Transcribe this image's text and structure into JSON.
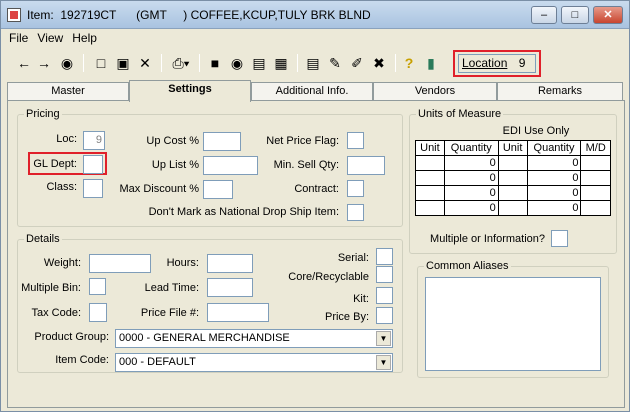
{
  "titlebar": {
    "title": "Item:  192719CT      (GMT     ) COFFEE,KCUP,TULY BRK BLND"
  },
  "menu": [
    {
      "label": "File"
    },
    {
      "label": "View"
    },
    {
      "label": "Help"
    }
  ],
  "location": {
    "label": "Location",
    "value": "9"
  },
  "tabs": [
    {
      "label": "Master"
    },
    {
      "label": "Settings"
    },
    {
      "label": "Additional Info."
    },
    {
      "label": "Vendors"
    },
    {
      "label": "Remarks"
    }
  ],
  "pricing": {
    "legend": "Pricing",
    "loc_label": "Loc:",
    "loc_value": "9",
    "gl_dept_label": "GL Dept:",
    "class_label": "Class:",
    "up_cost_label": "Up Cost %",
    "up_list_label": "Up List %",
    "max_discount_label": "Max Discount %",
    "net_price_flag_label": "Net Price Flag:",
    "min_sell_qty_label": "Min. Sell Qty:",
    "contract_label": "Contract:",
    "national_drop_ship_label": "Don't Mark as National Drop Ship Item:"
  },
  "details": {
    "legend": "Details",
    "weight_label": "Weight:",
    "multiple_bin_label": "Multiple Bin:",
    "tax_code_label": "Tax Code:",
    "hours_label": "Hours:",
    "lead_time_label": "Lead Time:",
    "price_file_label": "Price File #:",
    "serial_label": "Serial:",
    "core_recyclable_label": "Core/Recyclable",
    "kit_label": "Kit:",
    "price_by_label": "Price By:",
    "product_group_label": "Product Group:",
    "product_group_value": "0000 - GENERAL MERCHANDISE",
    "item_code_label": "Item Code:",
    "item_code_value": "000 - DEFAULT"
  },
  "uom": {
    "legend": "Units of Measure",
    "edi_label": "EDI Use Only",
    "headers": [
      "Unit",
      "Quantity",
      "Unit",
      "Quantity",
      "M/D"
    ],
    "rows": [
      [
        "",
        "0",
        "",
        "0",
        ""
      ],
      [
        "",
        "0",
        "",
        "0",
        ""
      ],
      [
        "",
        "0",
        "",
        "0",
        ""
      ],
      [
        "",
        "0",
        "",
        "0",
        ""
      ]
    ],
    "multiple_info_label": "Multiple or Information?"
  },
  "aliases": {
    "legend": "Common Aliases"
  },
  "colors": {
    "highlight": "#e0202a",
    "window_bg": "#ece9d8"
  }
}
